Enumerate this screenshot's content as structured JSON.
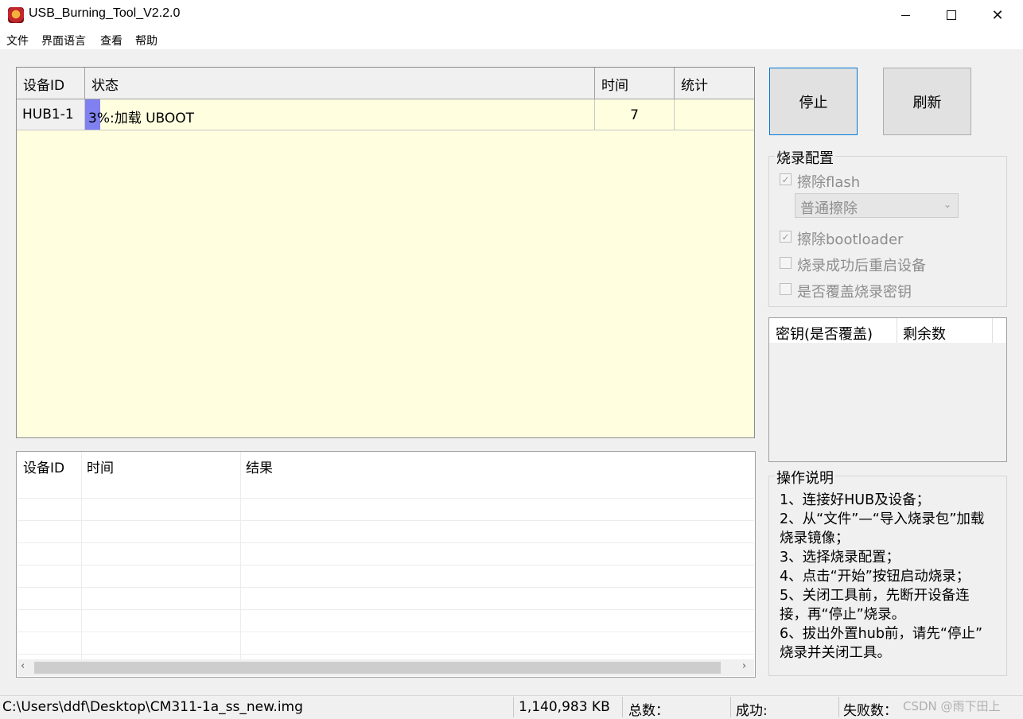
{
  "window": {
    "title": "USB_Burning_Tool_V2.2.0"
  },
  "menu": [
    "文件",
    "界面语言",
    "查看",
    "帮助"
  ],
  "device_table": {
    "columns": [
      "设备ID",
      "状态",
      "时间",
      "统计"
    ],
    "rows": [
      {
        "device_id": "HUB1-1",
        "progress_percent": 3,
        "status": "3%:加载 UBOOT",
        "time": "7",
        "stat": ""
      }
    ]
  },
  "log_table": {
    "columns": [
      "设备ID",
      "时间",
      "结果"
    ]
  },
  "buttons": {
    "stop": "停止",
    "refresh": "刷新"
  },
  "burn_config": {
    "title": "烧录配置",
    "erase_flash": {
      "label": "擦除flash",
      "checked": true
    },
    "erase_mode": {
      "value": "普通擦除"
    },
    "erase_bootloader": {
      "label": "擦除bootloader",
      "checked": true
    },
    "reboot_after": {
      "label": "烧录成功后重启设备",
      "checked": false
    },
    "overwrite_key": {
      "label": "是否覆盖烧录密钥",
      "checked": false
    }
  },
  "key_table": {
    "columns": [
      "密钥(是否覆盖)",
      "剩余数"
    ]
  },
  "instructions": {
    "title": "操作说明",
    "lines": [
      "1、连接好HUB及设备；",
      "2、从“文件”—“导入烧录包”加载",
      "烧录镜像；",
      "3、选择烧录配置；",
      "4、点击“开始”按钮启动烧录；",
      "5、关闭工具前，先断开设备连",
      "接，再“停止”烧录。",
      "6、拔出外置hub前，请先“停止”",
      "烧录并关闭工具。"
    ]
  },
  "status_bar": {
    "file_path": "C:\\Users\\ddf\\Desktop\\CM311-1a_ss_new.img",
    "file_size": "1,140,983 KB",
    "total": "总数：",
    "success": "成功:",
    "fail": "失败数：",
    "watermark": "CSDN @雨下田上"
  },
  "colors": {
    "progress": "#8080f0",
    "device_bg": "#ffffe0",
    "focus_border": "#0078d7"
  }
}
